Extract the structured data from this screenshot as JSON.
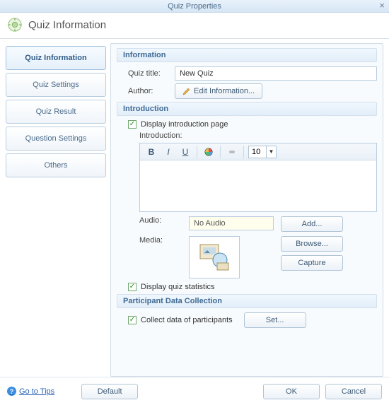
{
  "window": {
    "title": "Quiz Properties",
    "header_title": "Quiz Information"
  },
  "sidebar": {
    "items": [
      {
        "label": "Quiz Information",
        "active": true
      },
      {
        "label": "Quiz Settings",
        "active": false
      },
      {
        "label": "Quiz Result",
        "active": false
      },
      {
        "label": "Question Settings",
        "active": false
      },
      {
        "label": "Others",
        "active": false
      }
    ]
  },
  "sections": {
    "information": {
      "header": "Information",
      "quiz_title_label": "Quiz title:",
      "quiz_title_value": "New Quiz",
      "author_label": "Author:",
      "edit_info_btn": "Edit Information..."
    },
    "introduction": {
      "header": "Introduction",
      "display_intro_label": "Display introduction page",
      "display_intro_checked": true,
      "intro_label": "Introduction:",
      "font_size": "10",
      "audio_label": "Audio:",
      "audio_value": "No Audio",
      "media_label": "Media:",
      "add_btn": "Add...",
      "browse_btn": "Browse...",
      "capture_btn": "Capture",
      "display_stats_label": "Display quiz statistics",
      "display_stats_checked": true
    },
    "participant": {
      "header": "Participant Data Collection",
      "collect_label": "Collect data of participants",
      "collect_checked": true,
      "set_btn": "Set..."
    }
  },
  "footer": {
    "help_link": "Go to Tips",
    "default_btn": "Default",
    "ok_btn": "OK",
    "cancel_btn": "Cancel"
  }
}
